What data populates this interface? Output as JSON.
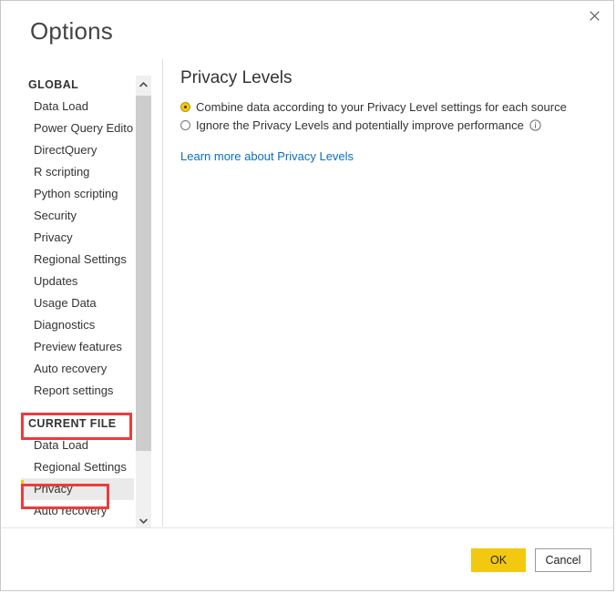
{
  "dialog": {
    "title": "Options",
    "close_icon": "close-icon"
  },
  "sidebar": {
    "groups": [
      {
        "header": "GLOBAL",
        "items": [
          "Data Load",
          "Power Query Editor",
          "DirectQuery",
          "R scripting",
          "Python scripting",
          "Security",
          "Privacy",
          "Regional Settings",
          "Updates",
          "Usage Data",
          "Diagnostics",
          "Preview features",
          "Auto recovery",
          "Report settings"
        ]
      },
      {
        "header": "CURRENT FILE",
        "items": [
          "Data Load",
          "Regional Settings",
          "Privacy",
          "Auto recovery"
        ],
        "selected_item": "Privacy"
      }
    ],
    "scrollbar": {
      "up_icon": "chevron-up-icon",
      "down_icon": "chevron-down-icon"
    }
  },
  "annotations": {
    "color": "#ed3b3b",
    "boxes": [
      {
        "target": "CURRENT FILE"
      },
      {
        "target": "Privacy"
      }
    ]
  },
  "content": {
    "heading": "Privacy Levels",
    "options": [
      {
        "label": "Combine data according to your Privacy Level settings for each source",
        "selected": true,
        "info_icon": null
      },
      {
        "label": "Ignore the Privacy Levels and potentially improve performance",
        "selected": false,
        "info_icon": "info-icon"
      }
    ],
    "link": "Learn more about Privacy Levels"
  },
  "footer": {
    "ok_label": "OK",
    "cancel_label": "Cancel"
  },
  "colors": {
    "accent": "#f2c811",
    "link": "#0b6ec4",
    "annotation": "#ed3b3b",
    "selected_row_bg": "#eaeaea"
  }
}
